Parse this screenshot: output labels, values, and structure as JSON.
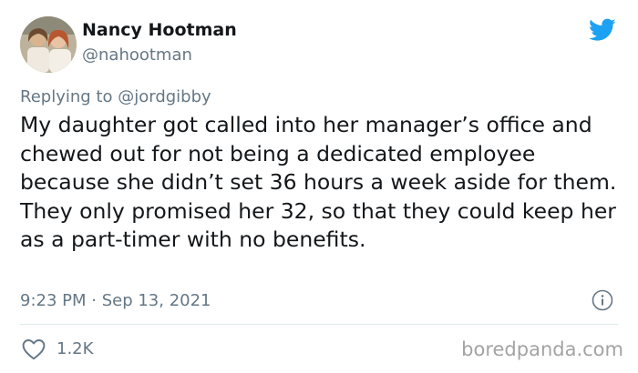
{
  "author": {
    "display_name": "Nancy Hootman",
    "handle": "@nahootman"
  },
  "reply": {
    "prefix": "Replying to",
    "to_handle": "@jordgibby"
  },
  "tweet": {
    "text": "My daughter got called into her manager’s office and chewed out for not being a dedicated employee because she didn’t set 36 hours a week aside for them. They only promised her 32, so that they could keep her as a part-timer with no benefits."
  },
  "meta": {
    "timestamp": "9:23 PM · Sep 13, 2021"
  },
  "actions": {
    "like_count": "1.2K"
  },
  "watermark": "boredpanda.com",
  "icons": {
    "brand": "twitter-bird-icon",
    "info": "info-icon",
    "like": "heart-icon"
  },
  "colors": {
    "twitter_blue": "#1da1f2",
    "secondary_text": "#657786",
    "primary_text": "#14171a",
    "divider": "#e1e8ed"
  }
}
